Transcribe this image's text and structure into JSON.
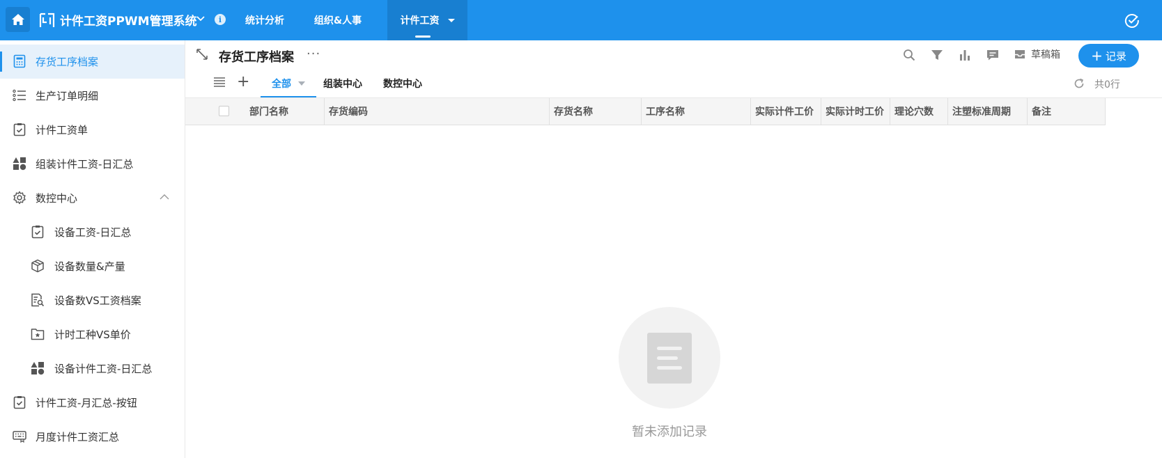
{
  "app": {
    "title": "计件工资PPWM管理系统",
    "info_glyph": "i"
  },
  "topnav": {
    "tabs": [
      {
        "label": "统计分析"
      },
      {
        "label": "组织&人事"
      },
      {
        "label": "计件工资"
      }
    ],
    "active_tab": "计件工资"
  },
  "sidebar": {
    "items": [
      {
        "label": "存货工序档案",
        "icon": "calculator-icon"
      },
      {
        "label": "生产订单明细",
        "icon": "list-icon"
      },
      {
        "label": "计件工资单",
        "icon": "clipboard-check-icon"
      },
      {
        "label": "组装计件工资-日汇总",
        "icon": "shapes-icon"
      },
      {
        "label": "数控中心",
        "icon": "gear-icon"
      },
      {
        "label": "设备工资-日汇总",
        "icon": "clipboard-check-icon"
      },
      {
        "label": "设备数量&产量",
        "icon": "cube-icon"
      },
      {
        "label": "设备数VS工资档案",
        "icon": "doc-search-icon"
      },
      {
        "label": "计时工种VS单价",
        "icon": "folder-star-icon"
      },
      {
        "label": "设备计件工资-日汇总",
        "icon": "shapes-icon"
      },
      {
        "label": "计件工资-月汇总-按钮",
        "icon": "clipboard-check-icon"
      },
      {
        "label": "月度计件工资汇总",
        "icon": "keyboard-icon"
      }
    ]
  },
  "main": {
    "page_title": "存货工序档案",
    "more_glyph": "···",
    "drafts_label": "草稿箱",
    "record_button": {
      "plus": "+",
      "label": "记录"
    },
    "view_tabs": [
      {
        "label": "全部"
      },
      {
        "label": "组装中心"
      },
      {
        "label": "数控中心"
      }
    ],
    "row_count": "共0行",
    "add_glyph": "+"
  },
  "table": {
    "columns": [
      "部门名称",
      "存货编码",
      "存货名称",
      "工序名称",
      "实际计件工价",
      "实际计时工价",
      "理论穴数",
      "注塑标准周期",
      "备注"
    ],
    "rows": []
  },
  "empty_state": {
    "text": "暂未添加记录"
  },
  "colors": {
    "primary": "#1e91ec",
    "primary_dark": "#187fd1",
    "sidebar_active_bg": "#e6f1fb"
  }
}
